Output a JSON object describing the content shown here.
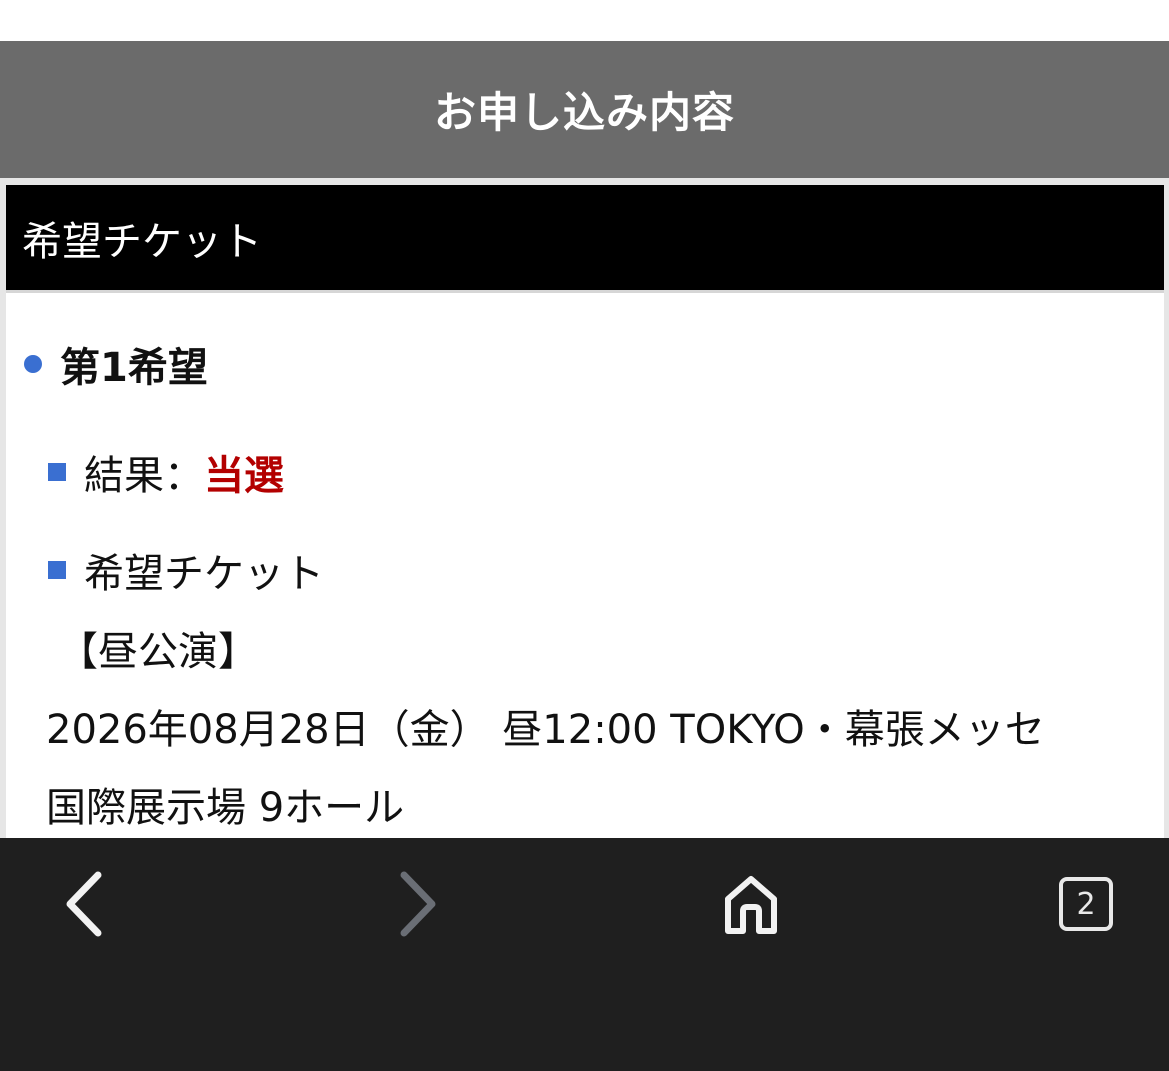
{
  "header": {
    "title": "お申し込み内容"
  },
  "section": {
    "title": "希望チケット"
  },
  "choice": {
    "title": "第1希望",
    "result_label": "結果：",
    "result_value": "当選",
    "ticket_label": "希望チケット",
    "performance": "【昼公演】",
    "detail_line1": "2026年08月28日（金） 昼12:00 TOKYO・幕張メッセ",
    "detail_line2": "国際展示場 9ホール"
  },
  "toolbar": {
    "back_icon": "chevron-left-icon",
    "forward_icon": "chevron-right-icon",
    "home_icon": "home-icon",
    "tab_count": "2"
  },
  "colors": {
    "header_bg": "#6b6b6b",
    "section_bg": "#000000",
    "accent_blue": "#3a6fd1",
    "result_red": "#b30000",
    "toolbar_bg": "#1f1f1f"
  }
}
